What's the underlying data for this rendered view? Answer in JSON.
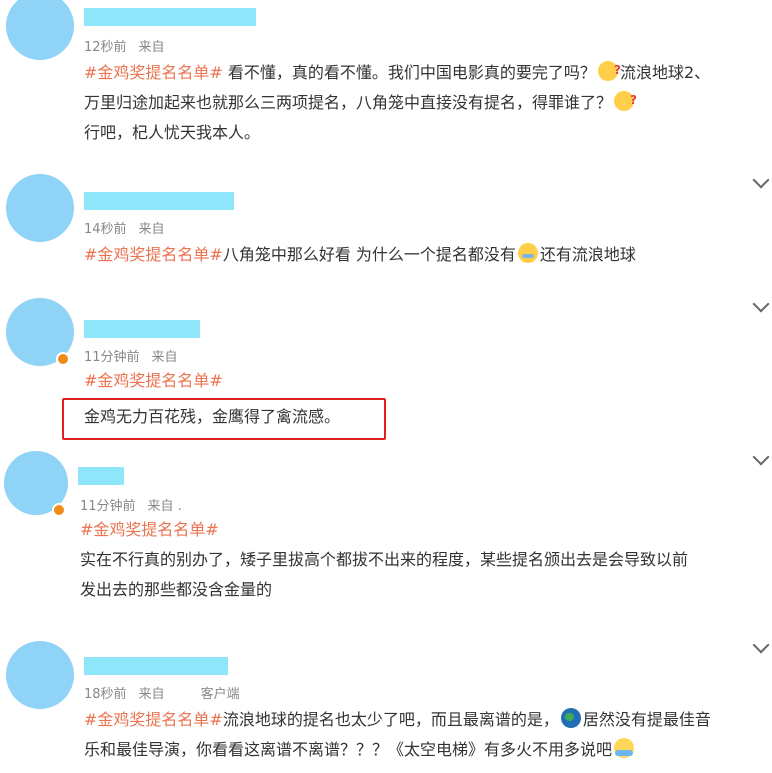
{
  "colors": {
    "hashtag": "#eb7350",
    "highlight": "#e02020",
    "avatar": "#8fd3f7",
    "name_mask": "#8fe6fb",
    "verified_badge": "#f08b1a"
  },
  "comments": [
    {
      "time": "12秒前",
      "source": "来自",
      "hashtag": "#金鸡奖提名名单#",
      "lines": [
        "看不懂，真的看不懂。我们中国电影真的要完了吗？",
        "流浪地球2、",
        "万里归途加起来也就那么三两项提名，八角笼中直接没有提名，得罪谁了？",
        "行吧，杞人忧天我本人。"
      ]
    },
    {
      "time": "14秒前",
      "source": "来自",
      "hashtag": "#金鸡奖提名名单#",
      "lines": [
        "八角笼中那么好看 为什么一个提名都没有",
        "还有流浪地球"
      ]
    },
    {
      "time": "11分钟前",
      "source": "来自",
      "hashtag": "#金鸡奖提名名单#",
      "lines": [
        "金鸡无力百花残，金鹰得了禽流感。"
      ]
    },
    {
      "time": "11分钟前",
      "source": "来自 .",
      "hashtag": "#金鸡奖提名名单#",
      "lines": [
        "实在不行真的别办了，矮子里拔高个都拔不出来的程度，某些提名颁出去是会导致以前",
        "发出去的那些都没含金量的"
      ]
    },
    {
      "time": "18秒前",
      "source": "来自",
      "client": "客户端",
      "hashtag": "#金鸡奖提名名单#",
      "lines": [
        "流浪地球的提名也太少了吧，而且最离谱的是，",
        "居然没有提最佳音",
        "乐和最佳导演，你看看这离谱不离谱？？？《太空电梯》有多火不用多说吧"
      ]
    }
  ],
  "icons": {
    "expand": "chevron-down-icon"
  }
}
